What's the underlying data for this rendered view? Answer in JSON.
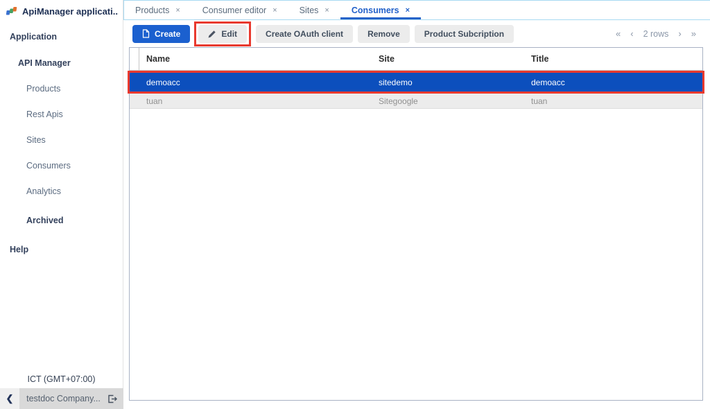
{
  "colors": {
    "accent_blue": "#1b60cf",
    "active_tab_blue": "#2160c9",
    "selected_row_blue": "#0c4fbd",
    "annotation_red": "#e8392e",
    "tabbar_border_blue": "#a7d9f2"
  },
  "sidebar": {
    "app_title": "ApiManager applicati...",
    "logo_icon": "app-logo-icon",
    "menu": [
      {
        "label": "Application"
      },
      {
        "label": "API Manager"
      },
      {
        "label": "Products"
      },
      {
        "label": "Rest Apis"
      },
      {
        "label": "Sites"
      },
      {
        "label": "Consumers"
      },
      {
        "label": "Analytics"
      },
      {
        "label": "Archived"
      },
      {
        "label": "Help"
      }
    ],
    "timezone": "ICT (GMT+07:00)",
    "company": "testdoc Company...",
    "collapse_glyph": "❮",
    "logout_icon": "logout-icon"
  },
  "tabs": {
    "close_glyph": "×",
    "items": [
      {
        "label": "Products"
      },
      {
        "label": "Consumer editor"
      },
      {
        "label": "Sites"
      },
      {
        "label": "Consumers"
      }
    ],
    "active_tab": "Consumers"
  },
  "toolbar": {
    "create_label": "Create",
    "create_icon": "new-document-icon",
    "edit_label": "Edit",
    "edit_icon": "pencil-icon",
    "oauth_label": "Create OAuth client",
    "remove_label": "Remove",
    "subscription_label": "Product Subcription"
  },
  "pagination": {
    "first": "«",
    "prev": "‹",
    "label": "2 rows",
    "next": "›",
    "last": "»"
  },
  "table": {
    "columns": [
      "Name",
      "Site",
      "Title"
    ],
    "rows": [
      {
        "name": "demoacc",
        "site": "sitedemo",
        "title": "demoacc",
        "selected": true
      },
      {
        "name": "tuan",
        "site": "Sitegoogle",
        "title": "tuan",
        "selected": false
      }
    ]
  }
}
